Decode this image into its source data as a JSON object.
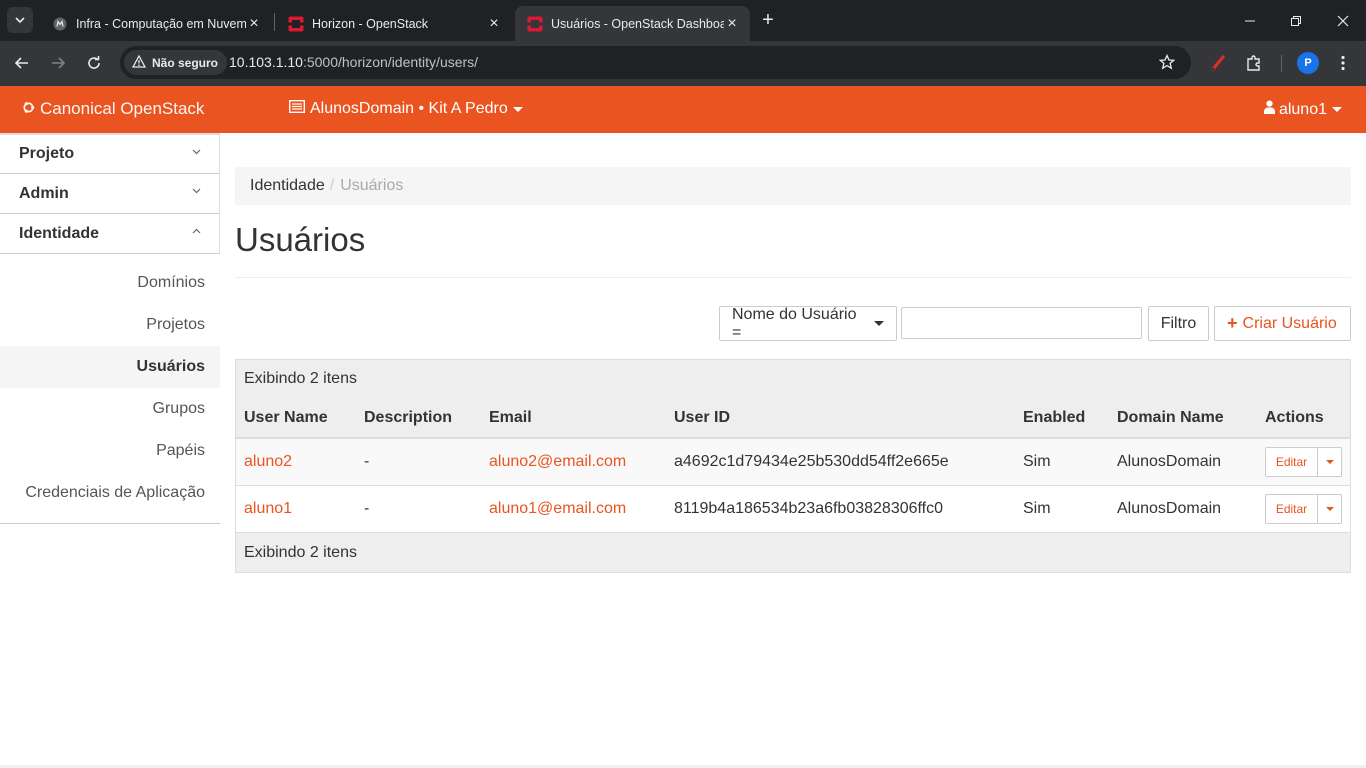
{
  "browser": {
    "tabs": [
      {
        "title": "Infra - Computação em Nuvem",
        "active": false
      },
      {
        "title": "Horizon - OpenStack",
        "active": false
      },
      {
        "title": "Usuários - OpenStack Dashboard",
        "active": true
      }
    ],
    "security_label": "Não seguro",
    "url_host": "10.103.1.10",
    "url_rest": ":5000/horizon/identity/users/",
    "profile_initial": "P"
  },
  "header": {
    "brand": "Canonical OpenStack",
    "context": "AlunosDomain • Kit A Pedro",
    "user": "aluno1"
  },
  "sidebar": {
    "panels": [
      {
        "label": "Projeto",
        "expanded": false
      },
      {
        "label": "Admin",
        "expanded": false
      },
      {
        "label": "Identidade",
        "expanded": true
      }
    ],
    "items": [
      {
        "label": "Domínios",
        "active": false
      },
      {
        "label": "Projetos",
        "active": false
      },
      {
        "label": "Usuários",
        "active": true
      },
      {
        "label": "Grupos",
        "active": false
      },
      {
        "label": "Papéis",
        "active": false
      },
      {
        "label": "Credenciais de Aplicação",
        "active": false
      }
    ]
  },
  "main": {
    "breadcrumb": {
      "parent": "Identidade",
      "current": "Usuários"
    },
    "title": "Usuários",
    "filter": {
      "select_label": "Nome do Usuário =",
      "input_value": "",
      "filter_button": "Filtro",
      "create_button": "Criar Usuário"
    },
    "table": {
      "caption": "Exibindo 2 itens",
      "footer": "Exibindo 2 itens",
      "columns": [
        "User Name",
        "Description",
        "Email",
        "User ID",
        "Enabled",
        "Domain Name",
        "Actions"
      ],
      "rows": [
        {
          "name": "aluno2",
          "description": "-",
          "email": "aluno2@email.com",
          "id": "a4692c1d79434e25b530dd54ff2e665e",
          "enabled": "Sim",
          "domain": "AlunosDomain",
          "action": "Editar"
        },
        {
          "name": "aluno1",
          "description": "-",
          "email": "aluno1@email.com",
          "id": "8119b4a186534b23a6fb03828306ffc0",
          "enabled": "Sim",
          "domain": "AlunosDomain",
          "action": "Editar"
        }
      ]
    }
  },
  "colors": {
    "accent": "#e95420",
    "chrome_dark": "#202124",
    "chrome_toolbar": "#35363a"
  }
}
